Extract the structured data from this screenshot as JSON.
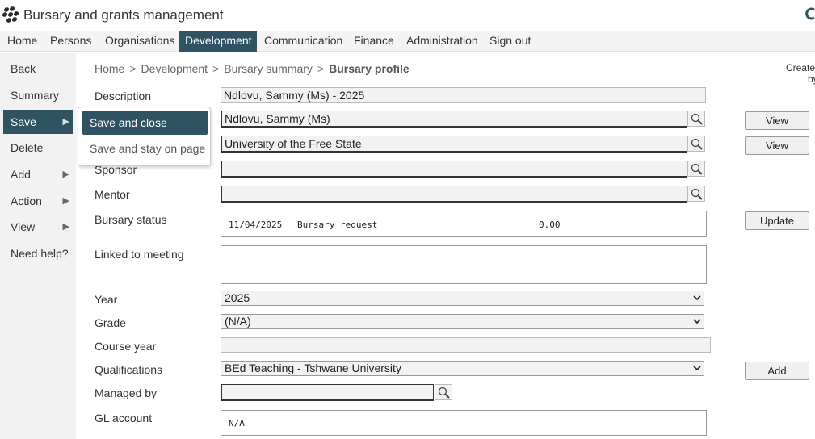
{
  "app": {
    "title": "Bursary and grants management"
  },
  "topnav": [
    {
      "label": "Home",
      "active": false
    },
    {
      "label": "Persons",
      "active": false
    },
    {
      "label": "Organisations",
      "active": false
    },
    {
      "label": "Development",
      "active": true
    },
    {
      "label": "Communication",
      "active": false
    },
    {
      "label": "Finance",
      "active": false
    },
    {
      "label": "Administration",
      "active": false
    },
    {
      "label": "Sign out",
      "active": false
    }
  ],
  "sidebar": {
    "items": [
      {
        "label": "Back",
        "has_arrow": false
      },
      {
        "label": "Summary",
        "has_arrow": false
      },
      {
        "label": "Save",
        "has_arrow": true,
        "active": true
      },
      {
        "label": "Delete",
        "has_arrow": false
      },
      {
        "label": "Add",
        "has_arrow": true
      },
      {
        "label": "Action",
        "has_arrow": true
      },
      {
        "label": "View",
        "has_arrow": true
      },
      {
        "label": "Need help?",
        "has_arrow": false
      }
    ]
  },
  "save_menu": {
    "items": [
      {
        "label": "Save and close",
        "active": true
      },
      {
        "label": "Save and stay on page",
        "active": false
      }
    ]
  },
  "breadcrumb": {
    "items": [
      "Home",
      "Development",
      "Bursary summary"
    ],
    "current": "Bursary profile",
    "separator": ">"
  },
  "created_by": {
    "line1": "Create",
    "line2": "by"
  },
  "form": {
    "description": {
      "label": "Description",
      "value": "Ndlovu, Sammy (Ms) - 2025"
    },
    "person": {
      "value": "Ndlovu, Sammy (Ms)",
      "button": "View"
    },
    "organisation": {
      "value": "University of the Free State",
      "button": "View"
    },
    "sponsor": {
      "label": "Sponsor",
      "value": ""
    },
    "mentor": {
      "label": "Mentor",
      "value": ""
    },
    "bursary_status": {
      "label": "Bursary status",
      "date": "11/04/2025",
      "status": "Bursary request",
      "amount": "0.00",
      "button": "Update"
    },
    "linked_to_meeting": {
      "label": "Linked to meeting",
      "value": ""
    },
    "year": {
      "label": "Year",
      "value": "2025"
    },
    "grade": {
      "label": "Grade",
      "value": "(N/A)"
    },
    "course_year": {
      "label": "Course year",
      "value": ""
    },
    "qualifications": {
      "label": "Qualifications",
      "value": "BEd Teaching - Tshwane University",
      "button": "Add"
    },
    "managed_by": {
      "label": "Managed by",
      "value": ""
    },
    "gl_account": {
      "label": "GL account",
      "value": "N/A"
    }
  },
  "colors": {
    "accent": "#2f5362",
    "nav_bg": "#f4f4f4",
    "field_bg": "#f2f2f2"
  },
  "icons": [
    "app-logo-icon",
    "search-icon",
    "chevron-down-icon",
    "triangle-right-icon"
  ]
}
